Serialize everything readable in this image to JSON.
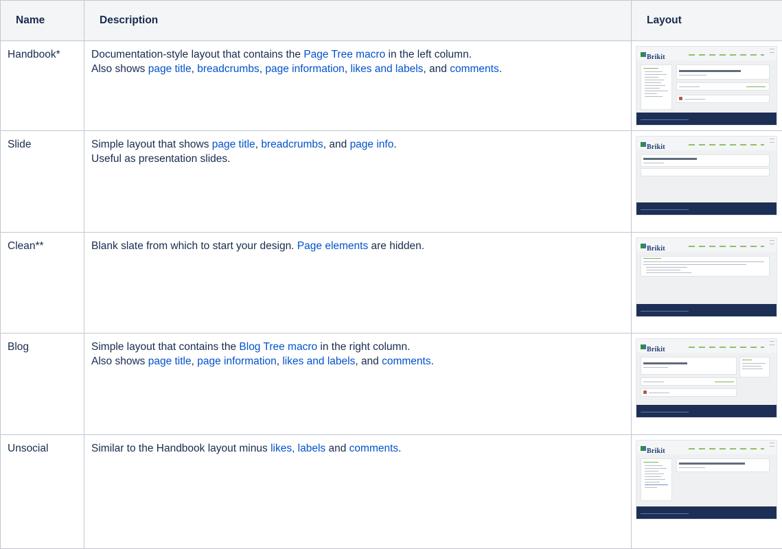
{
  "headers": {
    "name": "Name",
    "description": "Description",
    "layout": "Layout"
  },
  "thumbnail": {
    "logo": "Brikit"
  },
  "rows": [
    {
      "name": "Handbook*",
      "line1": [
        {
          "t": "Documentation-style layout that contains the "
        },
        {
          "t": "Page Tree macro",
          "link": true
        },
        {
          "t": " in the left column."
        }
      ],
      "line2": [
        {
          "t": "Also shows "
        },
        {
          "t": "page title",
          "link": true
        },
        {
          "t": ", "
        },
        {
          "t": "breadcrumbs",
          "link": true
        },
        {
          "t": ", "
        },
        {
          "t": "page information",
          "link": true
        },
        {
          "t": ", "
        },
        {
          "t": "likes and labels",
          "link": true
        },
        {
          "t": ", and "
        },
        {
          "t": "comments",
          "link": true
        },
        {
          "t": "."
        }
      ]
    },
    {
      "name": "Slide",
      "line1": [
        {
          "t": "Simple layout that shows "
        },
        {
          "t": "page title",
          "link": true
        },
        {
          "t": ", "
        },
        {
          "t": "breadcrumbs",
          "link": true
        },
        {
          "t": ", and "
        },
        {
          "t": "page info",
          "link": true
        },
        {
          "t": "."
        }
      ],
      "line2": [
        {
          "t": "Useful as presentation slides."
        }
      ]
    },
    {
      "name": "Clean**",
      "line1": [
        {
          "t": "Blank slate from which to start your design. "
        },
        {
          "t": "Page elements",
          "link": true
        },
        {
          "t": " are hidden."
        }
      ],
      "line2": []
    },
    {
      "name": "Blog",
      "line1": [
        {
          "t": "Simple layout that contains the "
        },
        {
          "t": "Blog Tree macro",
          "link": true
        },
        {
          "t": " in the right column."
        }
      ],
      "line2": [
        {
          "t": "Also shows "
        },
        {
          "t": "page title",
          "link": true
        },
        {
          "t": ", "
        },
        {
          "t": "page information",
          "link": true
        },
        {
          "t": ", "
        },
        {
          "t": "likes and labels",
          "link": true
        },
        {
          "t": ", and "
        },
        {
          "t": "comments",
          "link": true
        },
        {
          "t": "."
        }
      ]
    },
    {
      "name": "Unsocial",
      "line1": [
        {
          "t": "Similar to the Handbook layout minus "
        },
        {
          "t": "likes, labels",
          "link": true
        },
        {
          "t": " and "
        },
        {
          "t": "comments",
          "link": true
        },
        {
          "t": "."
        }
      ],
      "line2": []
    }
  ]
}
